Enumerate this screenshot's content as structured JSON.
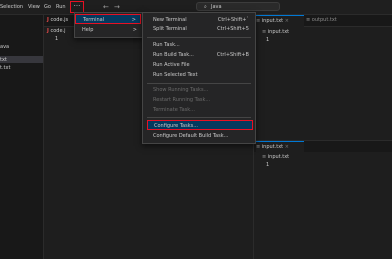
{
  "titlebar": {
    "menu": [
      "Selection",
      "View",
      "Go",
      "Run"
    ],
    "more": "···",
    "back": "←",
    "forward": "→",
    "search_text": "Java"
  },
  "sidebar": {
    "lines": [
      "ava",
      "txt",
      "t.txt"
    ]
  },
  "editor_left": {
    "tabs": [
      "code.js",
      "code.j"
    ],
    "line1": "1"
  },
  "right_top": {
    "tabs": [
      "input.txt",
      "output.txt"
    ],
    "breadcrumb": "input.txt",
    "line1": "1"
  },
  "right_bottom": {
    "tab": "input.txt",
    "breadcrumb": "input.txt",
    "line1": "1"
  },
  "top_menu": {
    "items": [
      {
        "label": "Terminal",
        "arrow": ">"
      },
      {
        "label": "Help",
        "arrow": ">"
      }
    ]
  },
  "terminal_menu": {
    "items": [
      {
        "label": "New Terminal",
        "key": "Ctrl+Shift+`"
      },
      {
        "label": "Split Terminal",
        "key": "Ctrl+Shift+5"
      },
      {
        "label": "Run Task...",
        "key": ""
      },
      {
        "label": "Run Build Task...",
        "key": "Ctrl+Shift+B"
      },
      {
        "label": "Run Active File",
        "key": ""
      },
      {
        "label": "Run Selected Text",
        "key": ""
      },
      {
        "label": "Show Running Tasks...",
        "key": ""
      },
      {
        "label": "Restart Running Task...",
        "key": ""
      },
      {
        "label": "Terminate Task...",
        "key": ""
      },
      {
        "label": "Configure Tasks...",
        "key": ""
      },
      {
        "label": "Configure Default Build Task...",
        "key": ""
      }
    ]
  },
  "colors": {
    "highlight_red": "#e81123",
    "active_blue": "#04395e",
    "accent_blue": "#0078d4"
  }
}
